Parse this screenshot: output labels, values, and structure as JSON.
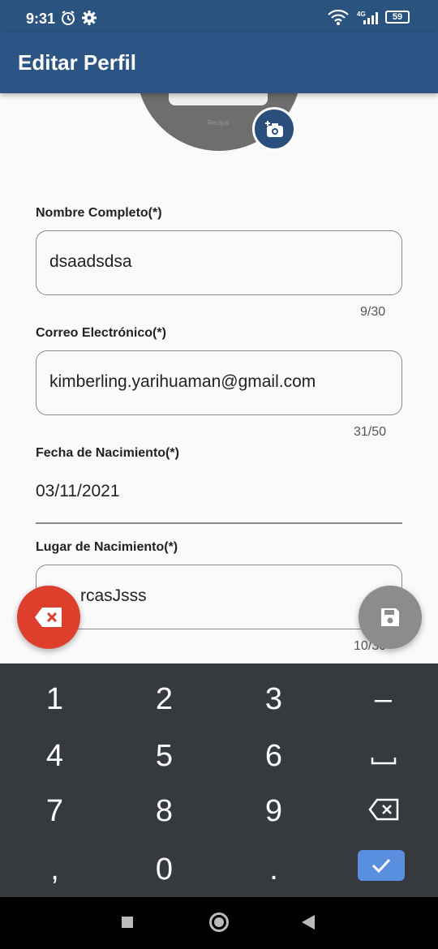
{
  "status_bar": {
    "time": "9:31",
    "network": "4G",
    "battery": "59"
  },
  "app_bar": {
    "title": "Editar Perfil"
  },
  "avatar": {
    "caption": "Recipal"
  },
  "form": {
    "full_name": {
      "label": "Nombre Completo(*)",
      "value": "dsaadsdsa",
      "counter": "9/30"
    },
    "email": {
      "label": "Correo Electrónico(*)",
      "value": "kimberling.yarihuaman@gmail.com",
      "counter": "31/50"
    },
    "birth_date": {
      "label": "Fecha de Nacimiento(*)",
      "value": "03/11/2021"
    },
    "birth_place": {
      "label": "Lugar de Nacimiento(*)",
      "value": "rcasJsss",
      "counter": "10/30"
    }
  },
  "keyboard": {
    "keys": [
      "1",
      "2",
      "3",
      "–",
      "4",
      "5",
      "6",
      "␣",
      "7",
      "8",
      "9",
      "⌫",
      ",",
      "0",
      "."
    ]
  },
  "colors": {
    "primary": "#2c5585",
    "clear_fab": "#de3e2c",
    "save_fab": "#8c8c8c",
    "keyboard_bg": "#363a3f",
    "done_key": "#5a8fe0"
  }
}
